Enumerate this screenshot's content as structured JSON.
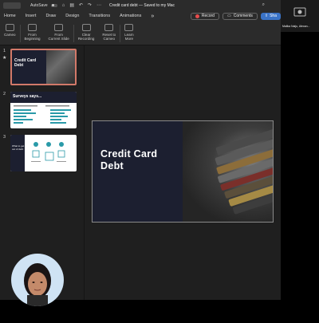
{
  "titlebar": {
    "autosave": "AutoSave",
    "doc_title": "Credit card debt  —  Saved to my Mac"
  },
  "tabs": [
    "Home",
    "Insert",
    "Draw",
    "Design",
    "Transitions",
    "Animations"
  ],
  "tabs_more": "»",
  "actions": {
    "record": "Record",
    "comments": "Comments",
    "share": "Sha"
  },
  "ribbon": [
    {
      "label": "Cameo"
    },
    {
      "label": "From\nBeginning"
    },
    {
      "label": "From\nCurrent Slide"
    },
    {
      "label": "Clear\nRecording"
    },
    {
      "label": "Reset to\nCameo"
    },
    {
      "label": "Learn\nMore"
    }
  ],
  "slides": [
    {
      "num": "1",
      "star": "★",
      "title": "Credit Card\nDebt"
    },
    {
      "num": "2",
      "title": "Surveys says..."
    },
    {
      "num": "3",
      "title": "What to get\nout of debt"
    }
  ],
  "main_slide": {
    "title": "Credit Card\nDebt"
  },
  "participant": {
    "name": "Malika Naiju, Alexan..."
  },
  "colors": {
    "slide_navy": "#1c1f30",
    "selected_border": "#d27969",
    "record_dot": "#e84c4c",
    "share_blue": "#3a73c7"
  }
}
